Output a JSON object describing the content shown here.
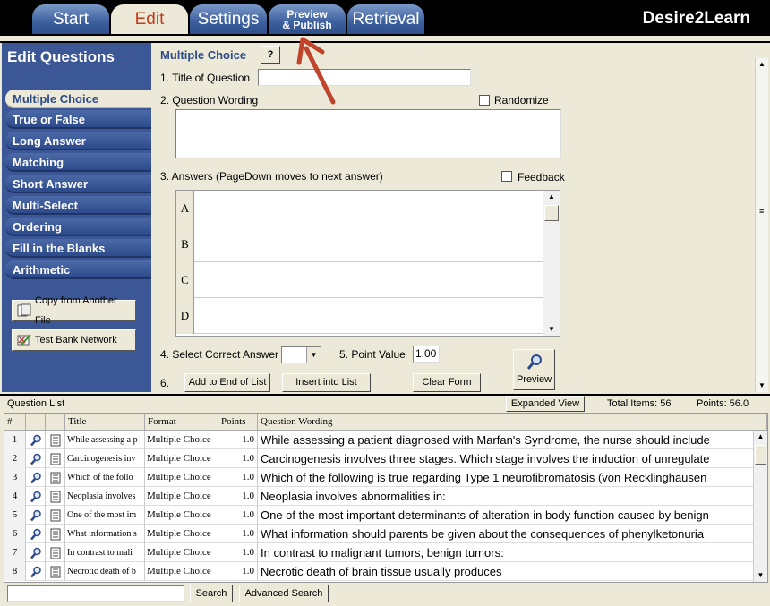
{
  "tabs": [
    {
      "label": "Start"
    },
    {
      "label": "Edit"
    },
    {
      "label": "Settings"
    },
    {
      "label_line1": "Preview",
      "label_line2": "& Publish"
    },
    {
      "label": "Retrieval"
    }
  ],
  "brand": "Desire2Learn",
  "left_panel": {
    "title": "Edit Questions",
    "question_types": [
      "Multiple Choice",
      "True or False",
      "Long Answer",
      "Matching",
      "Short Answer",
      "Multi-Select",
      "Ordering",
      "Fill in the Blanks",
      "Arithmetic"
    ],
    "copy_button": "Copy from Another File",
    "test_bank_button": "Test Bank Network"
  },
  "editor": {
    "heading": "Multiple Choice",
    "help_label": "?",
    "title_label": "1.  Title of Question",
    "title_value": "",
    "wording_label": "2.  Question Wording",
    "randomize_label": "Randomize",
    "answers_label": "3.  Answers  (PageDown moves to next answer)",
    "feedback_label": "Feedback",
    "answer_letters": [
      "A",
      "B",
      "C",
      "D"
    ],
    "correct_label": "4.  Select Correct Answer",
    "point_label": "5.  Point Value",
    "point_value": "1.00",
    "step6_label": "6.",
    "add_end_button": "Add to End of List",
    "insert_button": "Insert into List",
    "clear_button": "Clear Form",
    "preview_button": "Preview"
  },
  "question_list": {
    "label": "Question List",
    "expanded_view_button": "Expanded View",
    "total_items": "Total Items: 56",
    "points": "Points: 56.0",
    "headers": [
      "#",
      "",
      "",
      "Title",
      "Format",
      "Points",
      "Question Wording"
    ],
    "rows": [
      {
        "num": "1",
        "title": "While assessing a p",
        "format": "Multiple Choice",
        "points": "1.0",
        "wording": "While assessing a patient diagnosed with Marfan's Syndrome, the nurse should include"
      },
      {
        "num": "2",
        "title": "Carcinogenesis inv",
        "format": "Multiple Choice",
        "points": "1.0",
        "wording": "Carcinogenesis involves three stages. Which stage involves the induction of unregulate"
      },
      {
        "num": "3",
        "title": "Which of the follo",
        "format": "Multiple Choice",
        "points": "1.0",
        "wording": "Which of the following is true regarding Type 1 neurofibromatosis (von Recklinghausen"
      },
      {
        "num": "4",
        "title": "Neoplasia involves",
        "format": "Multiple Choice",
        "points": "1.0",
        "wording": "Neoplasia involves abnormalities in:"
      },
      {
        "num": "5",
        "title": "One of the most im",
        "format": "Multiple Choice",
        "points": "1.0",
        "wording": "One of the most important determinants of alteration in body function caused by benign"
      },
      {
        "num": "6",
        "title": "What information s",
        "format": "Multiple Choice",
        "points": "1.0",
        "wording": "What information should parents be given about the consequences of phenylketonuria"
      },
      {
        "num": "7",
        "title": "In contrast to mali",
        "format": "Multiple Choice",
        "points": "1.0",
        "wording": "In contrast to malignant tumors, benign tumors:"
      },
      {
        "num": "8",
        "title": "Necrotic death of b",
        "format": "Multiple Choice",
        "points": "1.0",
        "wording": "Necrotic death of brain tissue usually produces"
      }
    ]
  },
  "bottom": {
    "search_value": "",
    "search_button": "Search",
    "advanced_search_button": "Advanced Search"
  },
  "colors": {
    "accent_blue": "#3c5795",
    "active_tab_text": "#c23c1c",
    "arrow": "#c0432c"
  }
}
